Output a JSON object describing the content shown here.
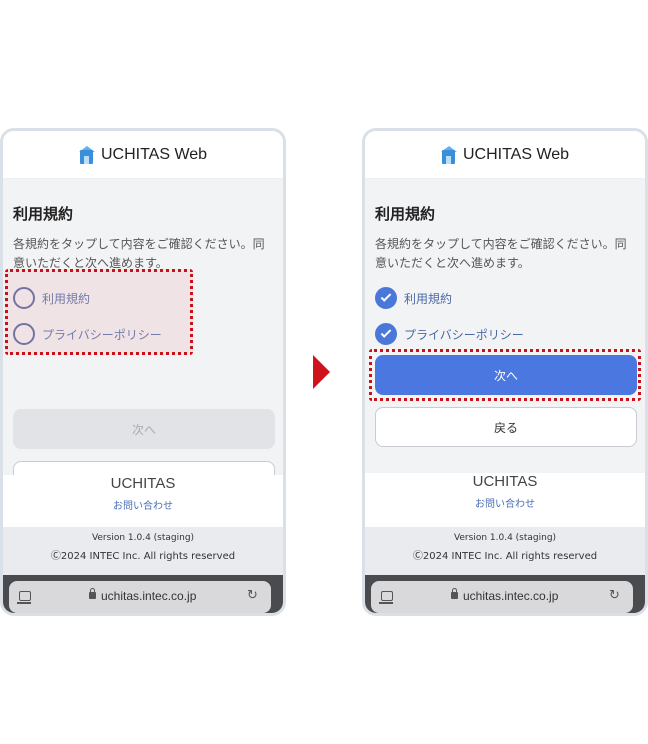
{
  "app": {
    "title": "UCHITAS Web"
  },
  "terms": {
    "heading": "利用規約",
    "description": "各規約をタップして内容をご確認ください。同意いただくと次へ進めます。",
    "items": [
      {
        "label": "利用規約"
      },
      {
        "label": "プライバシーポリシー"
      }
    ]
  },
  "buttons": {
    "next": "次へ",
    "back": "戻る"
  },
  "footer": {
    "brand": "UCHITAS",
    "contact": "お問い合わせ",
    "version": "Version 1.0.4 (staging)",
    "copyright": "Ⓒ2024 INTEC Inc. All rights reserved"
  },
  "browser": {
    "url": "uchitas.intec.co.jp"
  },
  "states": {
    "before": {
      "checked": [
        false,
        false
      ],
      "next_enabled": false
    },
    "after": {
      "checked": [
        true,
        true
      ],
      "next_enabled": true
    }
  },
  "colors": {
    "highlight": "#c8121a",
    "arrow": "#d0121b",
    "checked": "#4a78d9",
    "next_enabled": "#4a78e0"
  }
}
